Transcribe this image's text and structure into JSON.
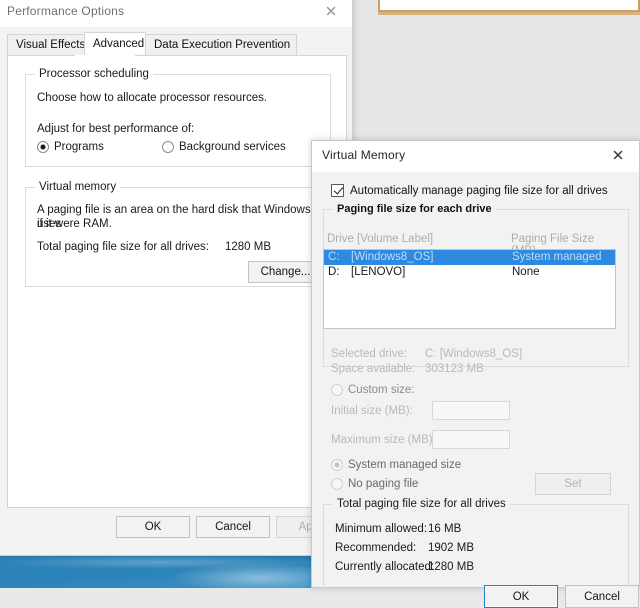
{
  "desktop": {
    "background_color": "#e6e6e6",
    "wallpaper_color": "#2e85ba"
  },
  "background_window": {
    "name": "partially-hidden-window",
    "border_color": "#c8a068"
  },
  "performance_options": {
    "title": "Performance Options",
    "close_icon": "close-icon",
    "tabs": [
      {
        "label": "Visual Effects",
        "active": false
      },
      {
        "label": "Advanced",
        "active": true
      },
      {
        "label": "Data Execution Prevention",
        "active": false
      }
    ],
    "processor_scheduling": {
      "legend": "Processor scheduling",
      "description": "Choose how to allocate processor resources.",
      "adjust_label": "Adjust for best performance of:",
      "options": [
        {
          "label": "Programs",
          "selected": true
        },
        {
          "label": "Background services",
          "selected": false
        }
      ]
    },
    "virtual_memory": {
      "legend": "Virtual memory",
      "description_line1": "A paging file is an area on the hard disk that Windows uses",
      "description_line2": "if it were RAM.",
      "total_label": "Total paging file size for all drives:",
      "total_value": "1280 MB",
      "change_button": "Change..."
    },
    "buttons": {
      "ok": "OK",
      "cancel": "Cancel",
      "apply": "Apply"
    }
  },
  "virtual_memory_dialog": {
    "title": "Virtual Memory",
    "close_icon": "close-icon",
    "auto_manage": {
      "label": "Automatically manage paging file size for all drives",
      "checked": true
    },
    "paging_group_legend": "Paging file size for each drive",
    "list_headers": {
      "drive": "Drive  [Volume Label]",
      "size": "Paging File Size (MB)"
    },
    "drives": [
      {
        "drive": "C:",
        "label": "[Windows8_OS]",
        "size": "System managed",
        "selected": true
      },
      {
        "drive": "D:",
        "label": "[LENOVO]",
        "size": "None",
        "selected": false
      }
    ],
    "selected_drive_label": "Selected drive:",
    "selected_drive_value": "C:  [Windows8_OS]",
    "space_available_label": "Space available:",
    "space_available_value": "303123 MB",
    "size_options": [
      {
        "name": "custom-size",
        "label": "Custom size:",
        "selected": false
      },
      {
        "name": "system-managed-size",
        "label": "System managed size",
        "selected": true
      },
      {
        "name": "no-paging-file",
        "label": "No paging file",
        "selected": false
      }
    ],
    "initial_size_label": "Initial size (MB):",
    "initial_size_value": "",
    "maximum_size_label": "Maximum size (MB):",
    "maximum_size_value": "",
    "set_button": "Set",
    "totals": {
      "legend": "Total paging file size for all drives",
      "rows": [
        {
          "label": "Minimum allowed:",
          "value": "16 MB"
        },
        {
          "label": "Recommended:",
          "value": "1902 MB"
        },
        {
          "label": "Currently allocated:",
          "value": "1280 MB"
        }
      ]
    },
    "buttons": {
      "ok": "OK",
      "cancel": "Cancel"
    },
    "accent_color": "#2d8ae0"
  }
}
